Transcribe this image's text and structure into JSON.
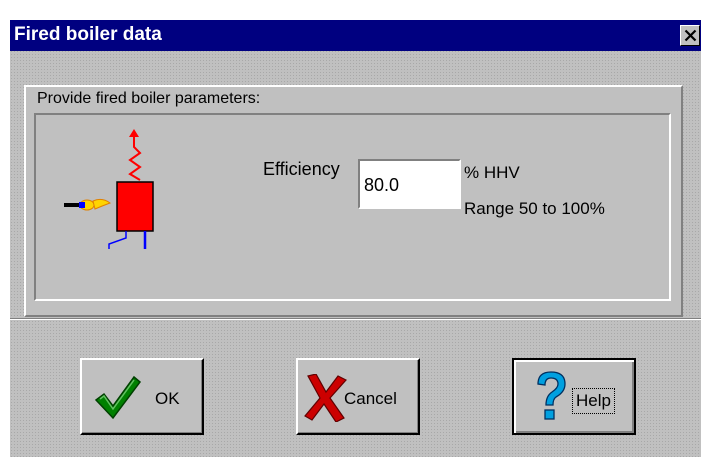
{
  "window": {
    "title": "Fired boiler data",
    "close_symbol": "✕"
  },
  "group": {
    "label": "Provide fired boiler parameters:"
  },
  "efficiency": {
    "label": "Efficiency",
    "value": "80.0",
    "unit": "% HHV",
    "range_text": "Range 50 to 100%"
  },
  "buttons": {
    "ok": "OK",
    "cancel": "Cancel",
    "help": "Help"
  },
  "icons": {
    "boiler": "fired-boiler-icon",
    "ok": "checkmark-icon",
    "cancel": "red-x-icon",
    "help": "question-mark-icon",
    "close": "close-icon"
  },
  "colors": {
    "titlebar": "#000080",
    "dialog_bg": "#c0c0c0",
    "boiler": "#ff0000",
    "check": "#008000",
    "help_q": "#00a0e0"
  }
}
